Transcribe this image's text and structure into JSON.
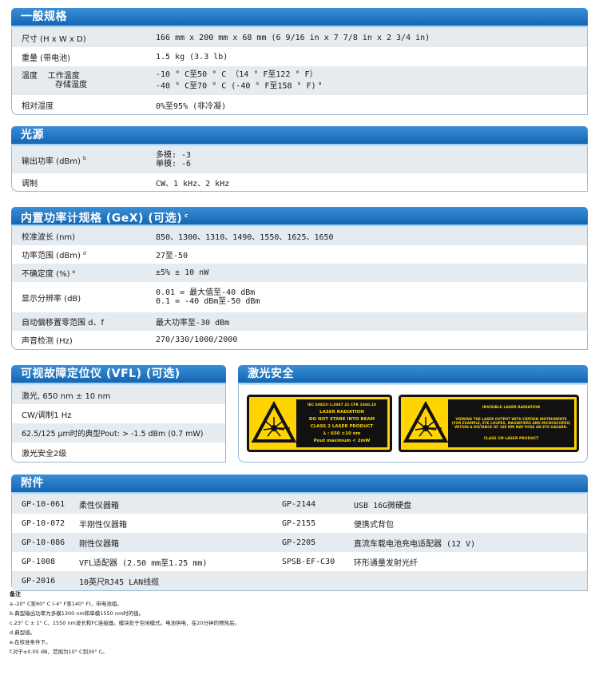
{
  "general": {
    "title": "一般规格",
    "rows": [
      {
        "key": "尺寸 (H x W x D)",
        "value": "166 mm x 200 mm x 68 mm (6 9/16 in x 7 7/8 in x 2 3/4 in)"
      },
      {
        "key": "重量 (带电池)",
        "value": "1.5 kg (3.3 lb)"
      },
      {
        "key_a": "温度",
        "key_b": "工作温度",
        "key_c": "存储温度",
        "value_1": "-10 ° C至50 ° C （14 ° F至122 ° F）",
        "value_2": "-40 ° C至70 ° C (-40 ° F至158 ° F)",
        "value_2_sup": "a"
      },
      {
        "key": "相对湿度",
        "value": "0%至95% (非冷凝)"
      }
    ]
  },
  "source": {
    "title": "光源",
    "rows": [
      {
        "key": "输出功率 (dBm)",
        "sup": "b",
        "value_1": "多模: -3",
        "value_2": "单模: -6"
      },
      {
        "key": "调制",
        "value": "CW、1 kHz、2 kHz"
      }
    ]
  },
  "powermeter": {
    "title": "内置功率计规格 (GeX) (可选)",
    "title_sup": "c",
    "rows": [
      {
        "key": "校准波长 (nm)",
        "value": "850、1300、1310、1490、1550、1625、1650"
      },
      {
        "key": "功率范围 (dBm)",
        "sup": "d",
        "value": "27至-50"
      },
      {
        "key": "不确定度 (%)",
        "sup": "e",
        "value": "±5% ± 10 nW"
      },
      {
        "key": "显示分辨率 (dB)",
        "value_1": "0.01 = 最大值至-40 dBm",
        "value_2": "0.1 = -40 dBm至-50 dBm"
      },
      {
        "key": "自动偏移置零范围 d、f",
        "value": "最大功率至-30 dBm"
      },
      {
        "key": "声音检测 (Hz)",
        "value": "270/330/1000/2000"
      }
    ]
  },
  "vfl": {
    "title": "可视故障定位仪 (VFL) (可选)",
    "rows": [
      "激光, 650 nm ± 10 nm",
      "CW/调制1 Hz",
      "62.5/125 μm时的典型Pout: > -1.5 dBm (0.7 mW)",
      "激光安全2级"
    ]
  },
  "laser": {
    "title": "激光安全",
    "label1": {
      "header": "IEC 60825-1:2007     21 CFR 1040.10",
      "l1": "LASER RADIATION",
      "l2": "DO NOT STARE INTO BEAM",
      "l3": "CLASS 2 LASER PRODUCT",
      "l4": "λ : 650 ±10 nm",
      "l5": "Pout maximum < 2mW"
    },
    "label2": {
      "l1": "INVISIBLE LASER RADIATION",
      "l2": "VIEWING THE LASER OUTPUT WITH CERTAIN INSTRUMENTS (FOR EXAMPLE, EYE LOUPES, MAGNIFIERS AND MICROSCOPES) WITHIN A DISTANCE OF 100 MM MAY POSE AN EYE HAZARD.",
      "l3": "CLASS 1M LASER PRODUCT"
    }
  },
  "accessories": {
    "title": "附件",
    "rows": [
      {
        "c1": "GP-10-061",
        "c2": "柔性仪器箱",
        "c3": "GP-2144",
        "c4": "USB 16G微硬盘"
      },
      {
        "c1": "GP-10-072",
        "c2": "半刚性仪器箱",
        "c3": "GP-2155",
        "c4": "便携式背包"
      },
      {
        "c1": "GP-10-086",
        "c2": "刚性仪器箱",
        "c3": "GP-2205",
        "c4": "直流车载电池充电适配器 (12 V)"
      },
      {
        "c1": "GP-1008",
        "c2": "VFL适配器 (2.50 mm至1.25 mm)",
        "c3": "SPSB-EF-C30",
        "c4": "环形通量发射光纤"
      },
      {
        "c1": "GP-2016",
        "c2": "10英尺RJ45 LAN线缆",
        "c3": "",
        "c4": ""
      }
    ]
  },
  "notes": {
    "title": "备注",
    "items": [
      "a.-20° C至60° C (-4° F至140° F)，带电池组。",
      "b.典型输出功率为多模1300 nm和单模1550 nm时的值。",
      "c.23° C ± 1° C、1550 nm波长和FC连接器。模块处于空闲模式。电池供电，在20分钟的预热后。",
      "d.典型值。",
      "e.在校准条件下。",
      "f.对于±0.05 dB，范围为10° C到30° C。"
    ]
  }
}
